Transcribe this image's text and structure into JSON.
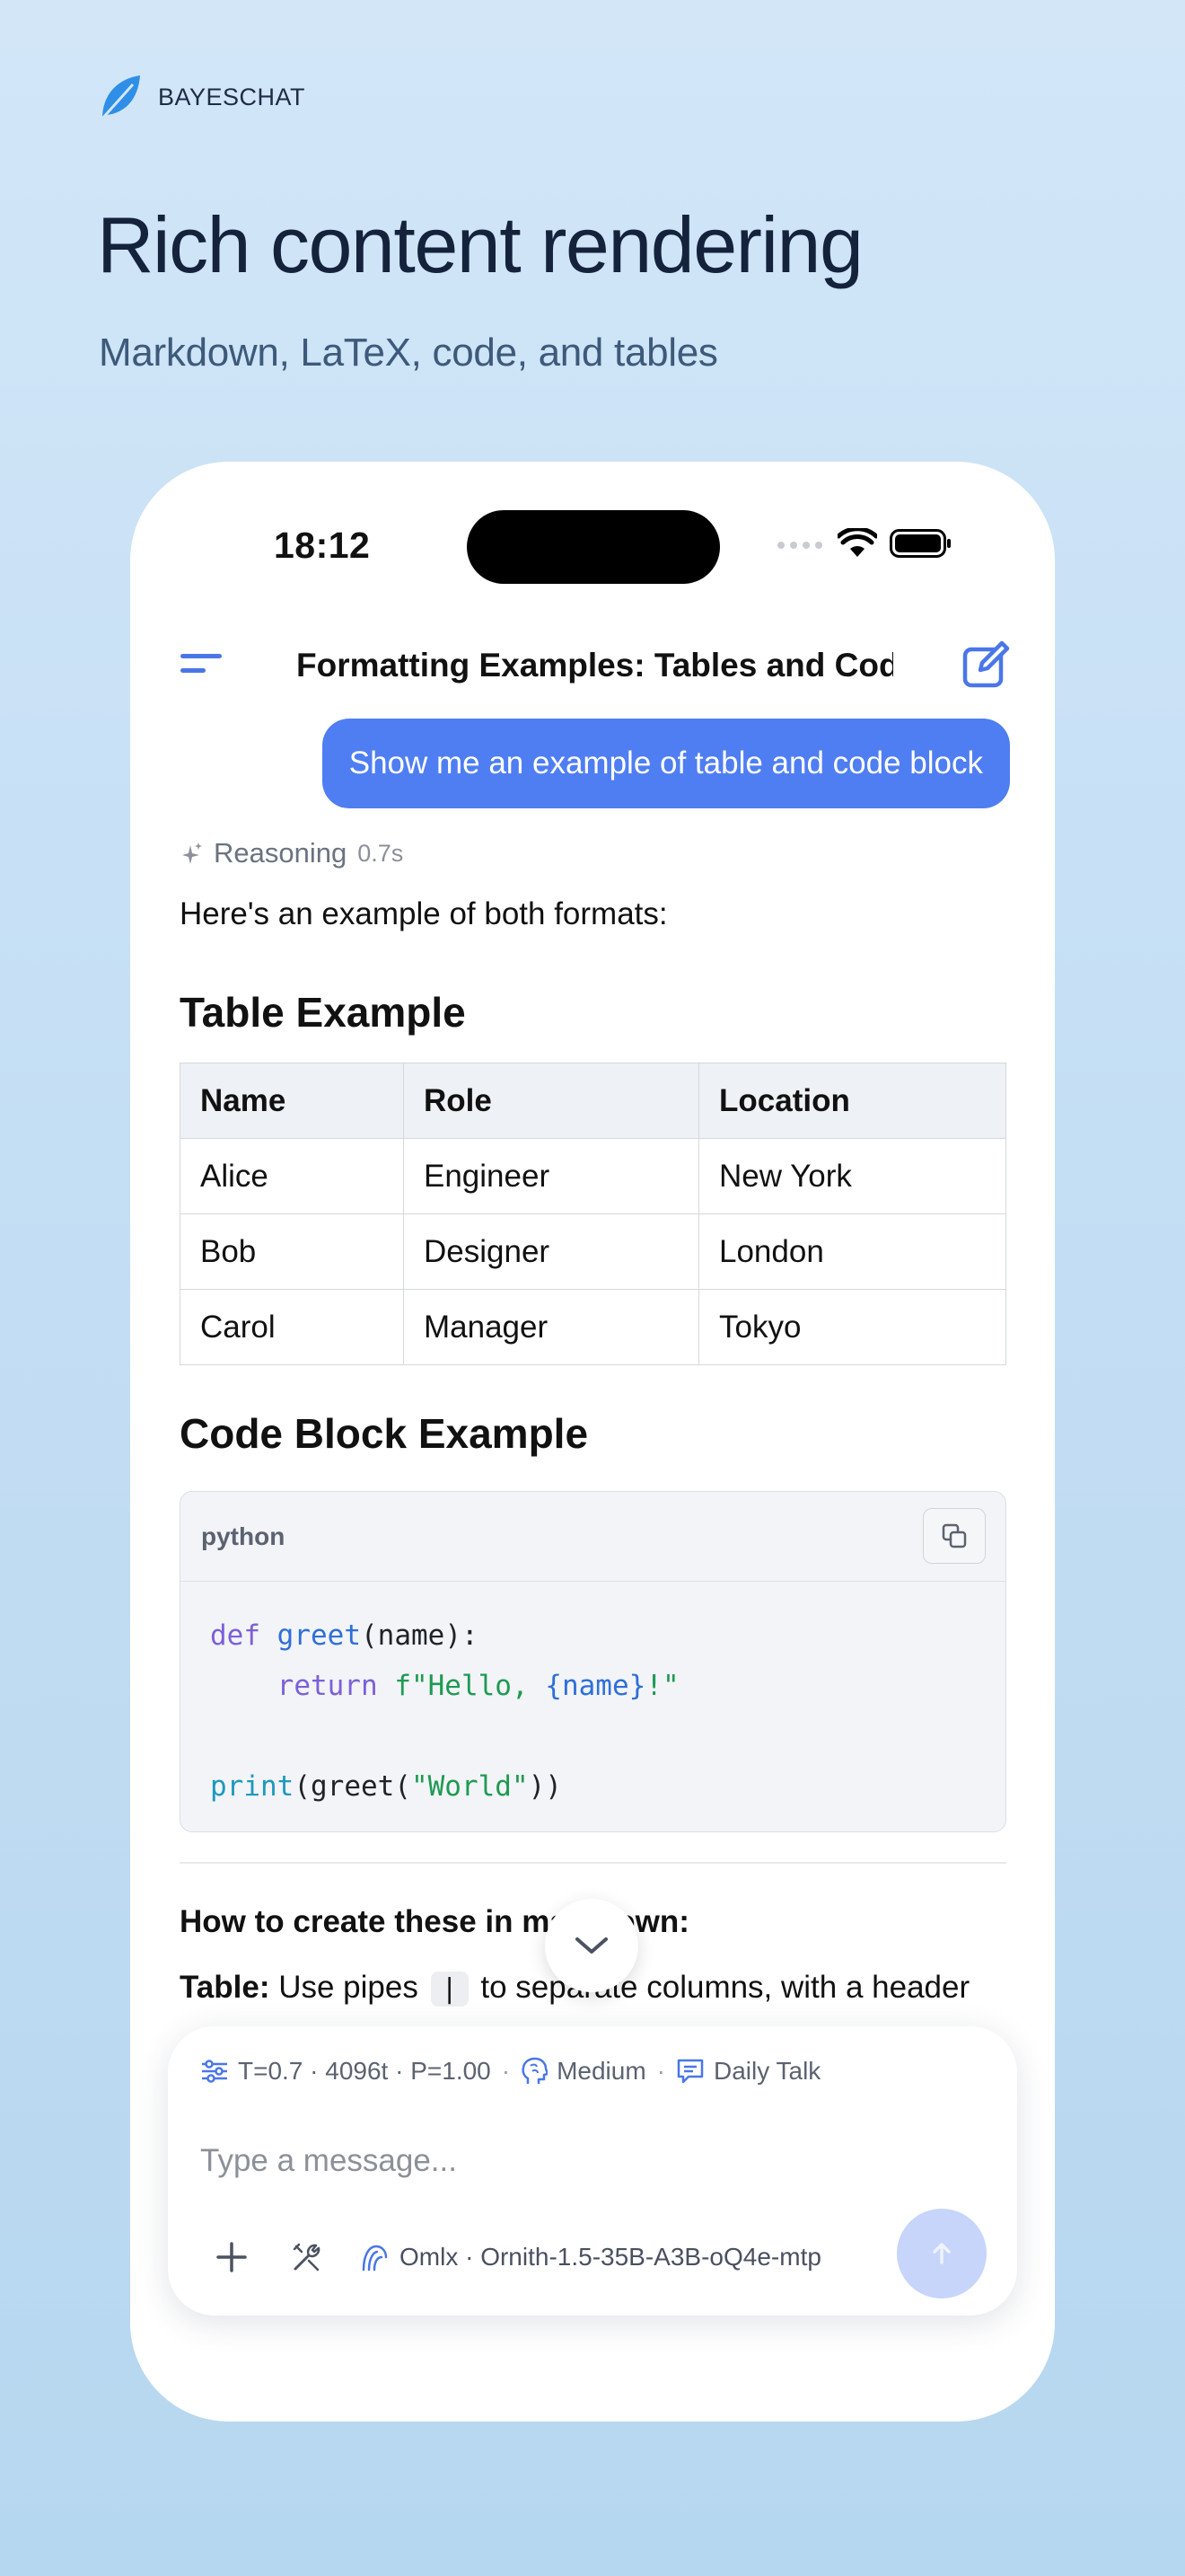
{
  "brand": {
    "name": "BAYESCHAT"
  },
  "hero": {
    "title": "Rich content rendering",
    "subtitle": "Markdown, LaTeX, code, and tables"
  },
  "status_bar": {
    "time": "18:12"
  },
  "chat": {
    "title": "Formatting Examples: Tables and Code",
    "user_message": "Show me an example of table and code block",
    "reasoning": {
      "label": "Reasoning",
      "time": "0.7s"
    },
    "intro": "Here's an example of both formats:",
    "table_heading": "Table Example",
    "table": {
      "headers": [
        "Name",
        "Role",
        "Location"
      ],
      "rows": [
        [
          "Alice",
          "Engineer",
          "New York"
        ],
        [
          "Bob",
          "Designer",
          "London"
        ],
        [
          "Carol",
          "Manager",
          "Tokyo"
        ]
      ]
    },
    "code_heading": "Code Block Example",
    "code": {
      "language": "python",
      "tokens": {
        "def": "def",
        "greet_fn": "greet",
        "params": "(name):",
        "return": "return",
        "fstr_open": "f\"Hello, ",
        "fstr_var": "{name}",
        "fstr_close": "!\"",
        "print_fn": "print",
        "call_open": "(greet(",
        "world_str": "\"World\"",
        "call_close": "))"
      }
    },
    "how_to_title": "How to create these in markdown:",
    "table_tip": {
      "label": "Table:",
      "before": "Use pipes",
      "code": "|",
      "after": "to separate columns, with a header"
    }
  },
  "composer": {
    "params": {
      "sampling": "T=0.7 · 4096t · P=1.00",
      "reasoning_level": "Medium",
      "preset": "Daily Talk"
    },
    "separator": "·",
    "placeholder": "Type a message...",
    "model": "Omlx · Ornith-1.5-35B-A3B-oQ4e-mtp"
  },
  "colors": {
    "accent": "#4f7ef2",
    "user_bubble": "#4f7ef2",
    "send_disabled": "#c7d5fb",
    "keyword": "#7c5fd9",
    "string": "#1e9a52"
  },
  "icons": {
    "logo": "leaf-logo-icon",
    "menu": "menu-icon",
    "compose": "compose-icon",
    "reasoning": "sparkle-icon",
    "copy": "copy-icon",
    "scroll": "chevron-down-icon",
    "sliders": "sliders-icon",
    "brain": "brain-icon",
    "chat": "chat-bubble-icon",
    "add": "plus-icon",
    "tools": "tools-icon",
    "model": "model-icon",
    "send": "send-icon"
  }
}
